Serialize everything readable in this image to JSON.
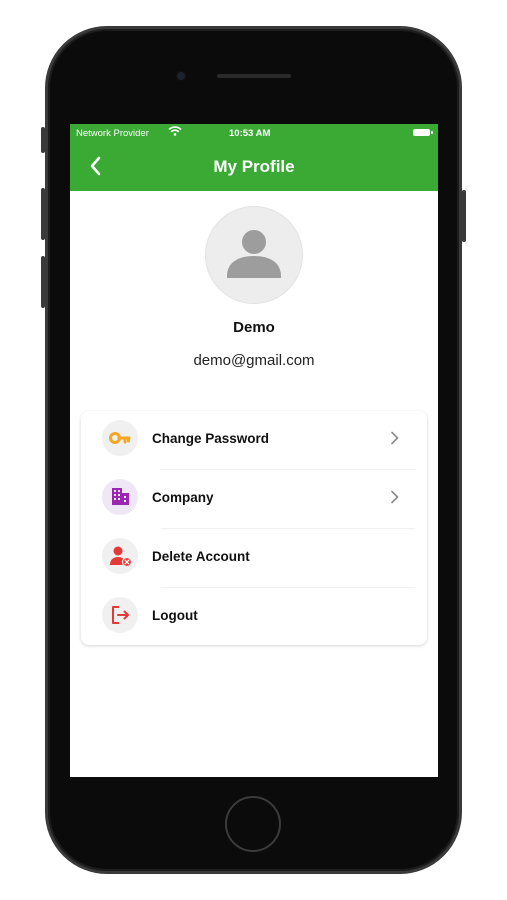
{
  "status_bar": {
    "carrier": "Network Provider",
    "time": "10:53 AM"
  },
  "header": {
    "title": "My Profile",
    "back_icon": "chevron-left-icon"
  },
  "profile": {
    "name": "Demo",
    "email": "demo@gmail.com",
    "avatar_icon": "person-silhouette-icon"
  },
  "menu": {
    "items": [
      {
        "label": "Change Password",
        "icon": "key-icon",
        "icon_color": "#f5a623",
        "icon_bg": "#f0f0f0",
        "chevron": true
      },
      {
        "label": "Company",
        "icon": "building-icon",
        "icon_color": "#9b27b0",
        "icon_bg": "#efe7f6",
        "chevron": true
      },
      {
        "label": "Delete Account",
        "icon": "user-remove-icon",
        "icon_color": "#e53935",
        "icon_bg": "#f0f0f0",
        "chevron": false
      },
      {
        "label": "Logout",
        "icon": "logout-icon",
        "icon_color": "#e53935",
        "icon_bg": "#f0f0f0",
        "chevron": false
      }
    ]
  },
  "colors": {
    "brand_green": "#3aaa35",
    "text": "#111111"
  }
}
